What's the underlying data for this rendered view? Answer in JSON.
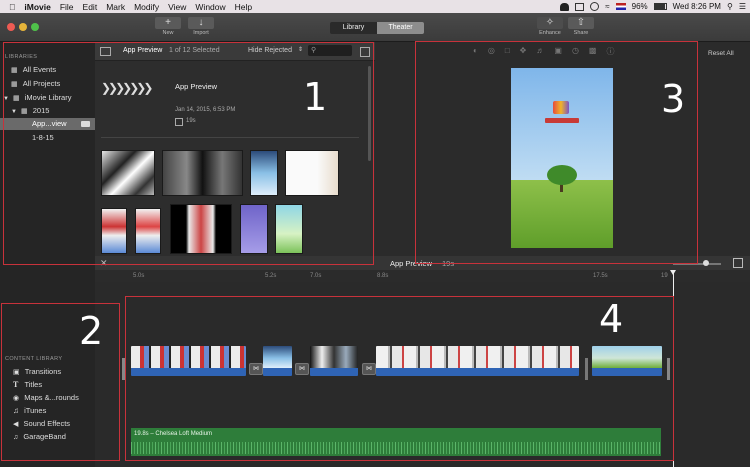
{
  "menubar": {
    "app": "iMovie",
    "items": [
      "File",
      "Edit",
      "Mark",
      "Modify",
      "View",
      "Window",
      "Help"
    ],
    "battery": "96%",
    "clock": "Wed 8:26 PM"
  },
  "toolbar": {
    "new_label": "New",
    "import_label": "Import",
    "library_label": "Library",
    "theater_label": "Theater",
    "enhance_label": "Enhance",
    "share_label": "Share"
  },
  "sidebar": {
    "header": "LIBRARIES",
    "items": [
      {
        "label": "All Events"
      },
      {
        "label": "All Projects"
      },
      {
        "label": "iMovie Library"
      },
      {
        "label": "2015"
      },
      {
        "label": "App...view"
      },
      {
        "label": "1-8-15"
      }
    ]
  },
  "browser": {
    "title": "App Preview",
    "selection_count": "1 of 12 Selected",
    "filter": "Hide Rejected",
    "project_name": "App Preview",
    "project_date": "Jan 14, 2015, 6:53 PM",
    "project_duration": "19s"
  },
  "viewer": {
    "reset_all": "Reset All"
  },
  "timeline": {
    "title": "App Preview",
    "duration": "19s",
    "ruler_ticks": [
      "5.0s",
      "5.2s",
      "7.0s",
      "8.8s",
      "17.5s",
      "19"
    ],
    "audio_label": "19.8s – Chelsea Loft Medium"
  },
  "content_library": {
    "header": "CONTENT LIBRARY",
    "items": [
      {
        "label": "Transitions"
      },
      {
        "label": "Titles"
      },
      {
        "label": "Maps &...rounds"
      },
      {
        "label": "iTunes"
      },
      {
        "label": "Sound Effects"
      },
      {
        "label": "GarageBand"
      }
    ]
  },
  "callouts": [
    "1",
    "2",
    "3",
    "4"
  ],
  "colors": {
    "callout_red": "#c8323b",
    "clip_blue": "#2f64b5",
    "audio_green": "#2e7d3a",
    "selection": "#707070"
  }
}
